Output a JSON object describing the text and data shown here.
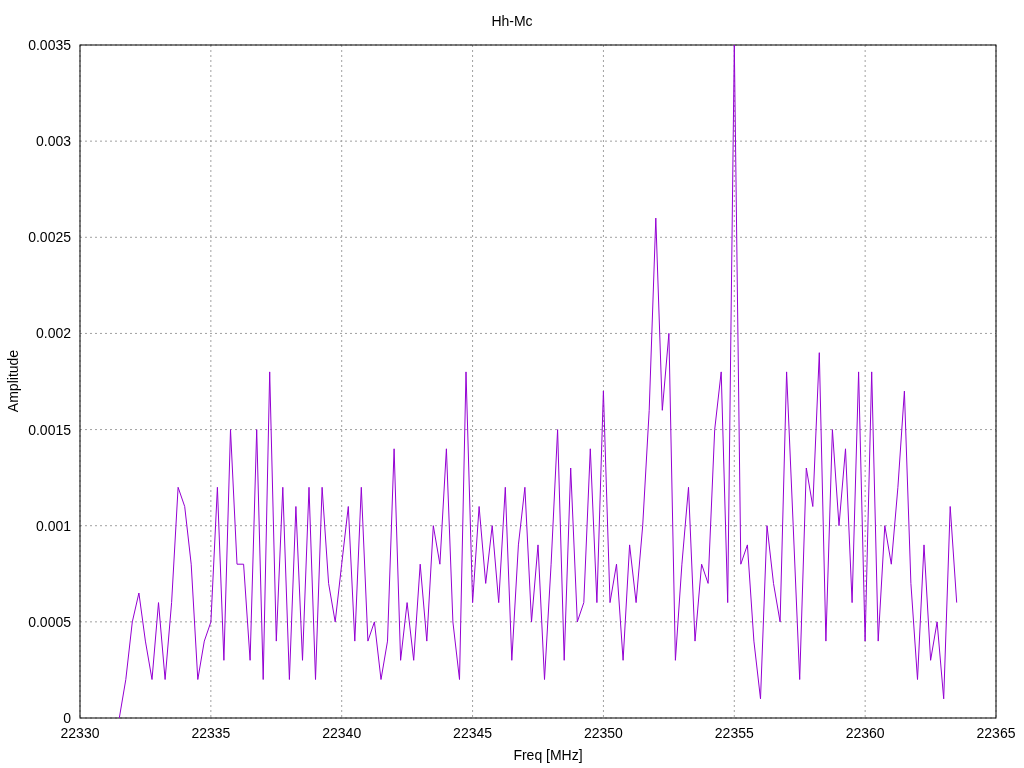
{
  "chart_data": {
    "type": "line",
    "title": "Hh-Mc",
    "xlabel": "Freq [MHz]",
    "ylabel": "Amplitude",
    "grid": true,
    "xlim": [
      22330,
      22365
    ],
    "ylim": [
      0,
      0.0035
    ],
    "xticks": [
      22330,
      22335,
      22340,
      22345,
      22350,
      22355,
      22360,
      22365
    ],
    "yticks": [
      0,
      0.0005,
      0.001,
      0.0015,
      0.002,
      0.0025,
      0.003,
      0.0035
    ],
    "x": [
      22331.5,
      22331.75,
      22332,
      22332.25,
      22332.5,
      22332.75,
      22333,
      22333.25,
      22333.5,
      22333.75,
      22334,
      22334.25,
      22334.5,
      22334.75,
      22335,
      22335.25,
      22335.5,
      22335.75,
      22336,
      22336.25,
      22336.5,
      22336.75,
      22337,
      22337.25,
      22337.5,
      22337.75,
      22338,
      22338.25,
      22338.5,
      22338.75,
      22339,
      22339.25,
      22339.5,
      22339.75,
      22340,
      22340.25,
      22340.5,
      22340.75,
      22341,
      22341.25,
      22341.5,
      22341.75,
      22342,
      22342.25,
      22342.5,
      22342.75,
      22343,
      22343.25,
      22343.5,
      22343.75,
      22344,
      22344.25,
      22344.5,
      22344.75,
      22345,
      22345.25,
      22345.5,
      22345.75,
      22346,
      22346.25,
      22346.5,
      22346.75,
      22347,
      22347.25,
      22347.5,
      22347.75,
      22348,
      22348.25,
      22348.5,
      22348.75,
      22349,
      22349.25,
      22349.5,
      22349.75,
      22350,
      22350.25,
      22350.5,
      22350.75,
      22351,
      22351.25,
      22351.5,
      22351.75,
      22352,
      22352.25,
      22352.5,
      22352.75,
      22353,
      22353.25,
      22353.5,
      22353.75,
      22354,
      22354.25,
      22354.5,
      22354.75,
      22355,
      22355.25,
      22355.5,
      22355.75,
      22356,
      22356.25,
      22356.5,
      22356.75,
      22357,
      22357.25,
      22357.5,
      22357.75,
      22358,
      22358.25,
      22358.5,
      22358.75,
      22359,
      22359.25,
      22359.5,
      22359.75,
      22360,
      22360.25,
      22360.5,
      22360.75,
      22361,
      22361.25,
      22361.5,
      22361.75,
      22362,
      22362.25,
      22362.5,
      22362.75,
      22363,
      22363.25,
      22363.5
    ],
    "series": [
      {
        "color": "#9400d3",
        "values": [
          0,
          0.0002,
          0.0005,
          0.00065,
          0.0004,
          0.0002,
          0.0006,
          0.0002,
          0.0006,
          0.0012,
          0.0011,
          0.0008,
          0.0002,
          0.0004,
          0.0005,
          0.0012,
          0.0003,
          0.0015,
          0.0008,
          0.0008,
          0.0003,
          0.0015,
          0.0002,
          0.0018,
          0.0004,
          0.0012,
          0.0002,
          0.0011,
          0.0003,
          0.0012,
          0.0002,
          0.0012,
          0.0007,
          0.0005,
          0.0008,
          0.0011,
          0.0004,
          0.0012,
          0.0004,
          0.0005,
          0.0002,
          0.0004,
          0.0014,
          0.0003,
          0.0006,
          0.0003,
          0.0008,
          0.0004,
          0.001,
          0.0008,
          0.0014,
          0.0005,
          0.0002,
          0.0018,
          0.0006,
          0.0011,
          0.0007,
          0.001,
          0.0006,
          0.0012,
          0.0003,
          0.0009,
          0.0012,
          0.0005,
          0.0009,
          0.0002,
          0.0008,
          0.0015,
          0.0003,
          0.0013,
          0.0005,
          0.0006,
          0.0014,
          0.0006,
          0.0017,
          0.0006,
          0.0008,
          0.0003,
          0.0009,
          0.0006,
          0.001,
          0.0016,
          0.0026,
          0.0016,
          0.002,
          0.0003,
          0.0008,
          0.0012,
          0.0004,
          0.0008,
          0.0007,
          0.0015,
          0.0018,
          0.0006,
          0.0035,
          0.0008,
          0.0009,
          0.0004,
          0.0001,
          0.001,
          0.0007,
          0.0005,
          0.0018,
          0.001,
          0.0002,
          0.0013,
          0.0011,
          0.0019,
          0.0004,
          0.0015,
          0.001,
          0.0014,
          0.0006,
          0.0018,
          0.0004,
          0.0018,
          0.0004,
          0.001,
          0.0008,
          0.0012,
          0.0017,
          0.0007,
          0.0002,
          0.0009,
          0.0003,
          0.0005,
          0.0001,
          0.0011,
          0.0006
        ]
      }
    ]
  }
}
